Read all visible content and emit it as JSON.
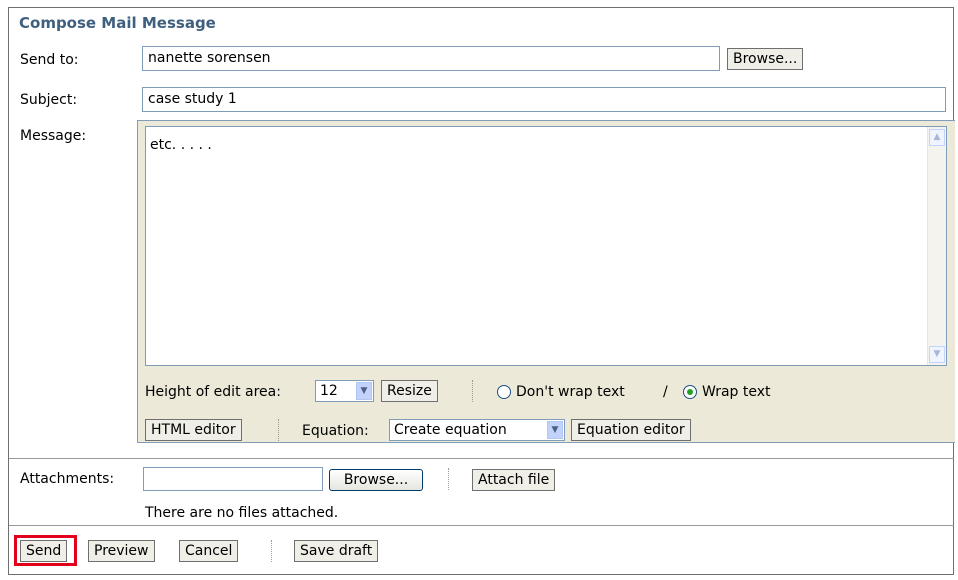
{
  "form": {
    "title": "Compose Mail Message",
    "send_to_label": "Send to:",
    "send_to_value": "nanette sorensen",
    "browse_label": "Browse...",
    "subject_label": "Subject:",
    "subject_value": "case study 1",
    "message_label": "Message:",
    "message_value": "etc. . . . .",
    "height_label": "Height of edit area:",
    "height_value": "12",
    "resize_label": "Resize",
    "dont_wrap_label": "Don't wrap text",
    "slash": "/",
    "wrap_label": "Wrap text",
    "wrap_selected": "wrap",
    "html_editor_label": "HTML editor",
    "equation_label": "Equation:",
    "equation_value": "Create equation",
    "equation_editor_label": "Equation editor",
    "attachments_label": "Attachments:",
    "attach_browse_label": "Browse...",
    "attach_file_label": "Attach file",
    "no_files_text": "There are no files attached.",
    "send_label": "Send",
    "preview_label": "Preview",
    "cancel_label": "Cancel",
    "save_draft_label": "Save draft"
  },
  "icons": {
    "scroll_up": "scroll-up-arrow-icon",
    "scroll_down": "scroll-down-arrow-icon",
    "dropdown": "chevron-down-icon"
  },
  "colors": {
    "title": "#3f5f7f",
    "highlight": "#e3001b",
    "radio_selected": "#21a121"
  }
}
